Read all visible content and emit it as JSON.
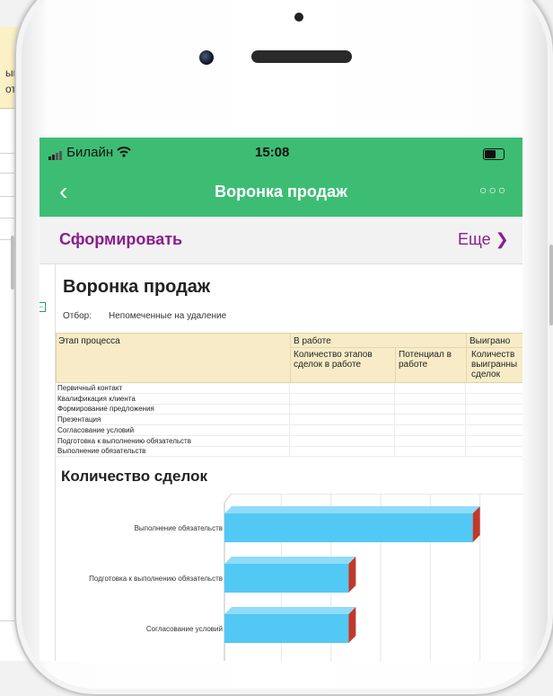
{
  "background_window": {
    "line1": "ый",
    "line2": "от"
  },
  "status_bar": {
    "carrier": "Билайн",
    "time": "15:08"
  },
  "nav": {
    "back_icon": "chevron-left-icon",
    "title": "Воронка продаж",
    "more_icon": "ellipsis-icon"
  },
  "command_bar": {
    "form_label": "Сформировать",
    "more_label": "Еще ❯"
  },
  "report": {
    "title": "Воронка продаж",
    "filter_label": "Отбор:",
    "filter_value": "Непомеченные на удаление",
    "table": {
      "col_stage": "Этап процесса",
      "group_in_work": "В работе",
      "col_count_in_work_1": "Количество этапов",
      "col_count_in_work_2": "сделок в работе",
      "col_potential_1": "Потенциал в",
      "col_potential_2": "работе",
      "group_won": "Выиграно",
      "col_won_1": "Количеств",
      "col_won_2": "выигранны",
      "col_won_3": "сделок",
      "rows": [
        "Первичный контакт",
        "Квалификация клиента",
        "Формирование предложения",
        "Презентация",
        "Согласование условий",
        "Подготовка к выполнению обязательств",
        "Выполнение обязательств"
      ]
    }
  },
  "chart_title": "Количество сделок",
  "chart_data": {
    "type": "bar",
    "orientation": "horizontal",
    "title": "Количество сделок",
    "categories": [
      "Выполнение обязательств",
      "Подготовка к выполнению обязательств",
      "Согласование условий"
    ],
    "values": [
      1.0,
      0.5,
      0.5
    ],
    "xlim": [
      0,
      1.2
    ],
    "grid": true,
    "colors": {
      "bar_face": "#52c8f5",
      "bar_top": "#8fdcfa",
      "bar_side": "#c0392b"
    }
  }
}
